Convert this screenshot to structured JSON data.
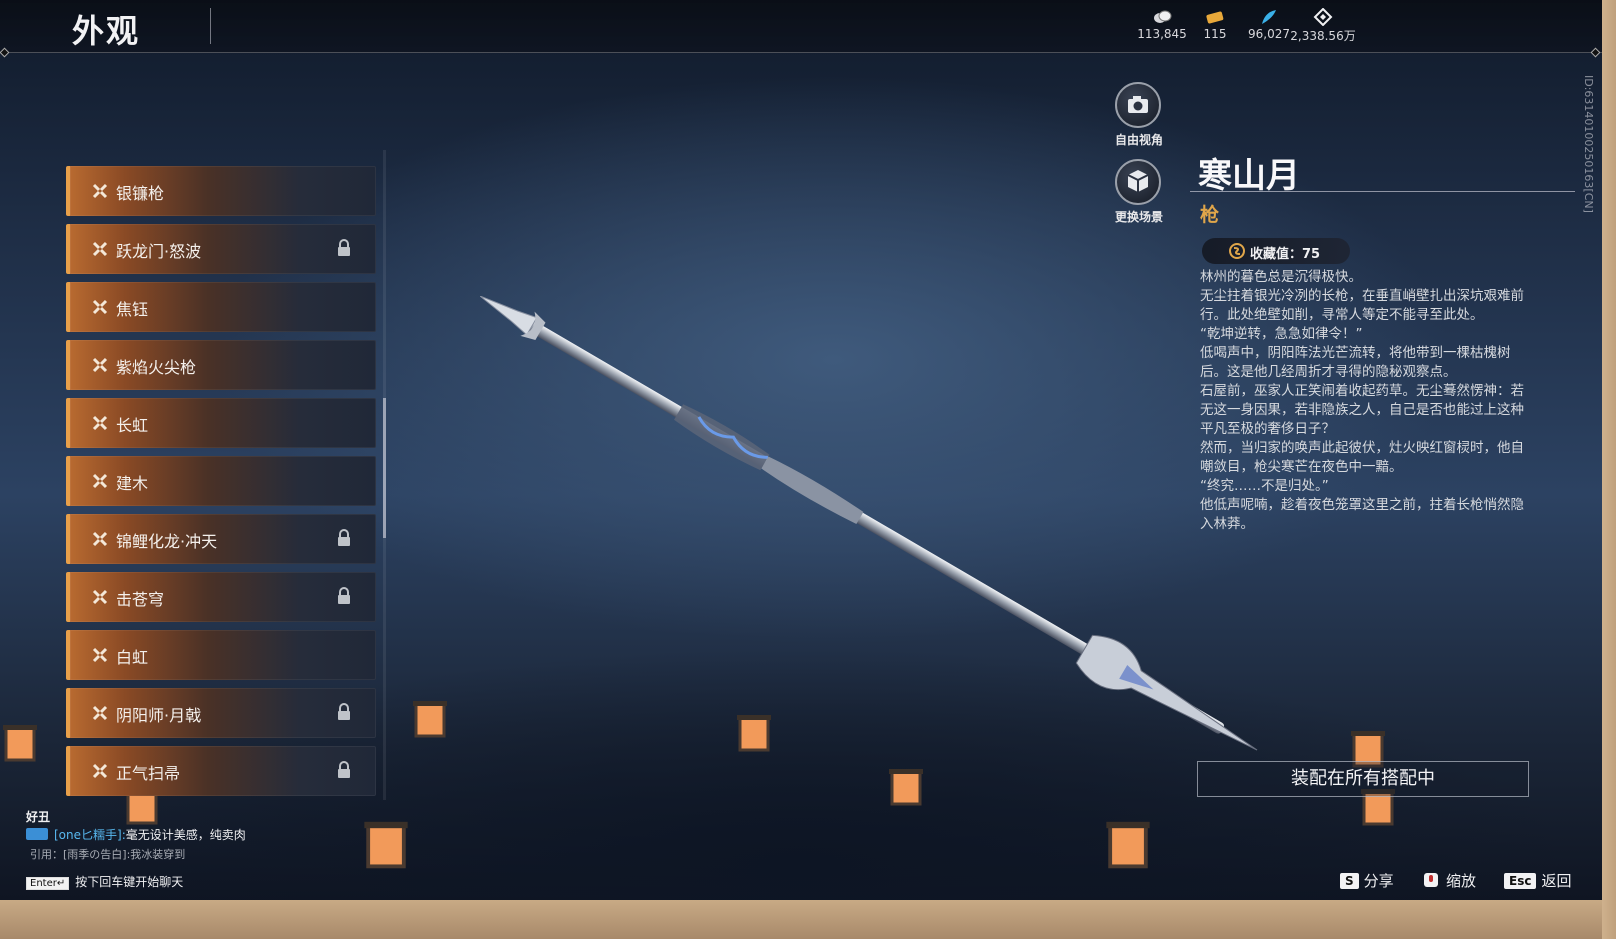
{
  "header": {
    "title": "外观",
    "currencies": [
      {
        "icon": "silver-coin-icon",
        "value": "113,845"
      },
      {
        "icon": "gold-ticket-icon",
        "value": "115"
      },
      {
        "icon": "feather-icon",
        "value": "96,027"
      },
      {
        "icon": "diamond-icon",
        "value": "2,338.56万"
      }
    ]
  },
  "list": {
    "items": [
      {
        "label": "银镰枪",
        "locked": false
      },
      {
        "label": "跃龙门·怒波",
        "locked": true
      },
      {
        "label": "焦钰",
        "locked": false
      },
      {
        "label": "紫焰火尖枪",
        "locked": false
      },
      {
        "label": "长虹",
        "locked": false
      },
      {
        "label": "建木",
        "locked": false
      },
      {
        "label": "锦鲤化龙·冲天",
        "locked": true
      },
      {
        "label": "击苍穹",
        "locked": true
      },
      {
        "label": "白虹",
        "locked": false
      },
      {
        "label": "阴阳师·月戟",
        "locked": true
      },
      {
        "label": "正气扫帚",
        "locked": true
      }
    ]
  },
  "view_buttons": {
    "free_view": "自由视角",
    "change_scene": "更换场景"
  },
  "detail": {
    "name": "寒山月",
    "type": "枪",
    "collect_value": "收藏值：75",
    "lore": [
      "林州的暮色总是沉得极快。",
      "无尘拄着银光冷冽的长枪，在垂直峭壁扎出深坑艰难前行。此处绝壁如削，寻常人等定不能寻至此处。",
      "“乾坤逆转，急急如律令！”",
      "低喝声中，阴阳阵法光芒流转，将他带到一棵枯槐树后。这是他几经周折才寻得的隐秘观察点。",
      "石屋前，巫家人正笑闹着收起药草。无尘蓦然愣神：若无这一身因果，若非隐族之人，自己是否也能过上这种平凡至极的奢侈日子？",
      "然而，当归家的唤声此起彼伏，灶火映红窗棂时，他自嘲敛目，枪尖寒芒在夜色中一黯。",
      "“终究……不是归处。”",
      "他低声呢喃，趁着夜色笼罩这里之前，拄着长枪悄然隐入林莽。"
    ],
    "equip_button": "装配在所有搭配中",
    "id_text": "ID:6314010025016​3[CN]"
  },
  "hints": [
    {
      "key": "S",
      "label": "分享"
    },
    {
      "key": "zoom-icon",
      "label": "缩放"
    },
    {
      "key": "Esc",
      "label": "返回"
    }
  ],
  "chat": {
    "name": "好丑",
    "user": "[one匕糯手]:",
    "message": "毫无设计美感，纯卖肉",
    "quote": "引用：[雨季の告白]:我冰装穿到",
    "enter_key": "Enter↵",
    "input_hint": "按下回车键开始聊天"
  },
  "colors": {
    "accent_orange": "#e8a04a",
    "type_gold": "#e0a64a",
    "chat_user": "#58b9f0"
  }
}
